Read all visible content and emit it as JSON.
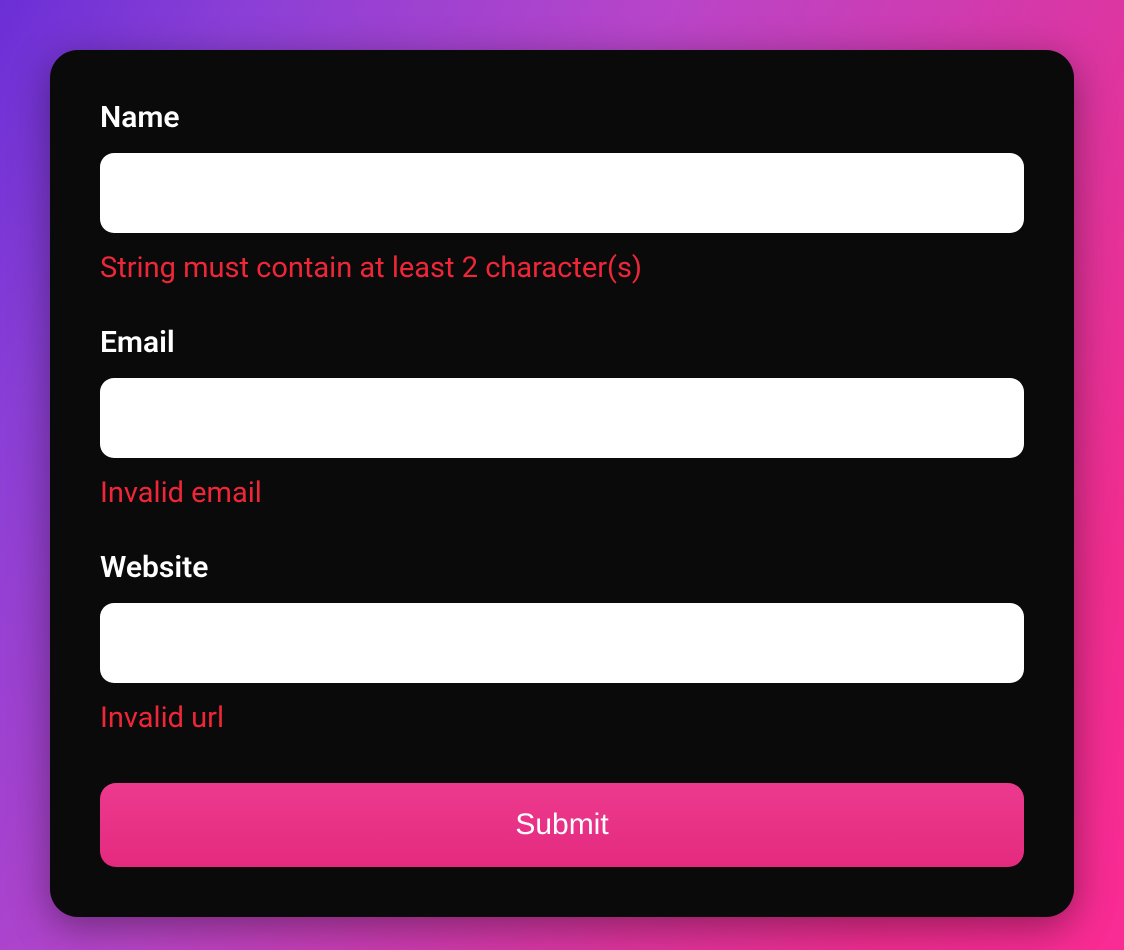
{
  "form": {
    "fields": {
      "name": {
        "label": "Name",
        "value": "",
        "error": "String must contain at least 2 character(s)"
      },
      "email": {
        "label": "Email",
        "value": "",
        "error": "Invalid email"
      },
      "website": {
        "label": "Website",
        "value": "",
        "error": "Invalid url"
      }
    },
    "submit_label": "Submit"
  },
  "colors": {
    "error": "#ef2637",
    "accent": "#ec3a8e",
    "card_bg": "#0a0a0a",
    "text": "#ffffff"
  }
}
